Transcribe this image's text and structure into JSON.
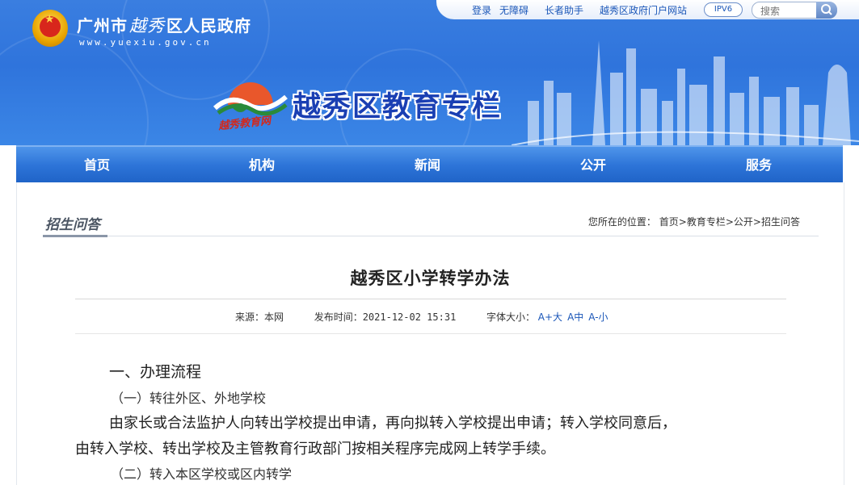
{
  "topbar": {
    "links": [
      "登录",
      "无障碍",
      "长者助手",
      "越秀区政府门户网站"
    ],
    "ipv6": "IPV6",
    "search_placeholder": "搜索"
  },
  "gov": {
    "name_prefix": "广州市",
    "name_calligraphy": "越秀",
    "name_suffix": "区人民政府",
    "url": "www.yuexiu.gov.cn"
  },
  "column": {
    "title": "越秀区教育专栏",
    "subtitle": "越秀教育网"
  },
  "nav": [
    "首页",
    "机构",
    "新闻",
    "公开",
    "服务"
  ],
  "section": {
    "title": "招生问答",
    "breadcrumb_label": "您所在的位置：",
    "breadcrumb": [
      "首页",
      "教育专栏",
      "公开",
      "招生问答"
    ],
    "breadcrumb_sep": ">"
  },
  "article": {
    "title": "越秀区小学转学办法",
    "source_label": "来源：",
    "source": "本网",
    "date_label": "发布时间：",
    "date": "2021-12-02 15:31",
    "fontsize_label": "字体大小：",
    "fontsize_options": [
      "A+大",
      "A中",
      "A-小"
    ],
    "heading1": "一、办理流程",
    "sub1": "（一）转往外区、外地学校",
    "para1_line1": "由家长或合法监护人向转出学校提出申请，再向拟转入学校提出申请；转入学校同意后，",
    "para1_line2": "由转入学校、转出学校及主管教育行政部门按相关程序完成网上转学手续。",
    "sub2": "（二）转入本区学校或区内转学"
  },
  "colors": {
    "banner_blue": "#2f74dc",
    "nav_blue": "#2d74d8",
    "title_blue": "#1a3fb3",
    "link_blue": "#1a56b8"
  }
}
